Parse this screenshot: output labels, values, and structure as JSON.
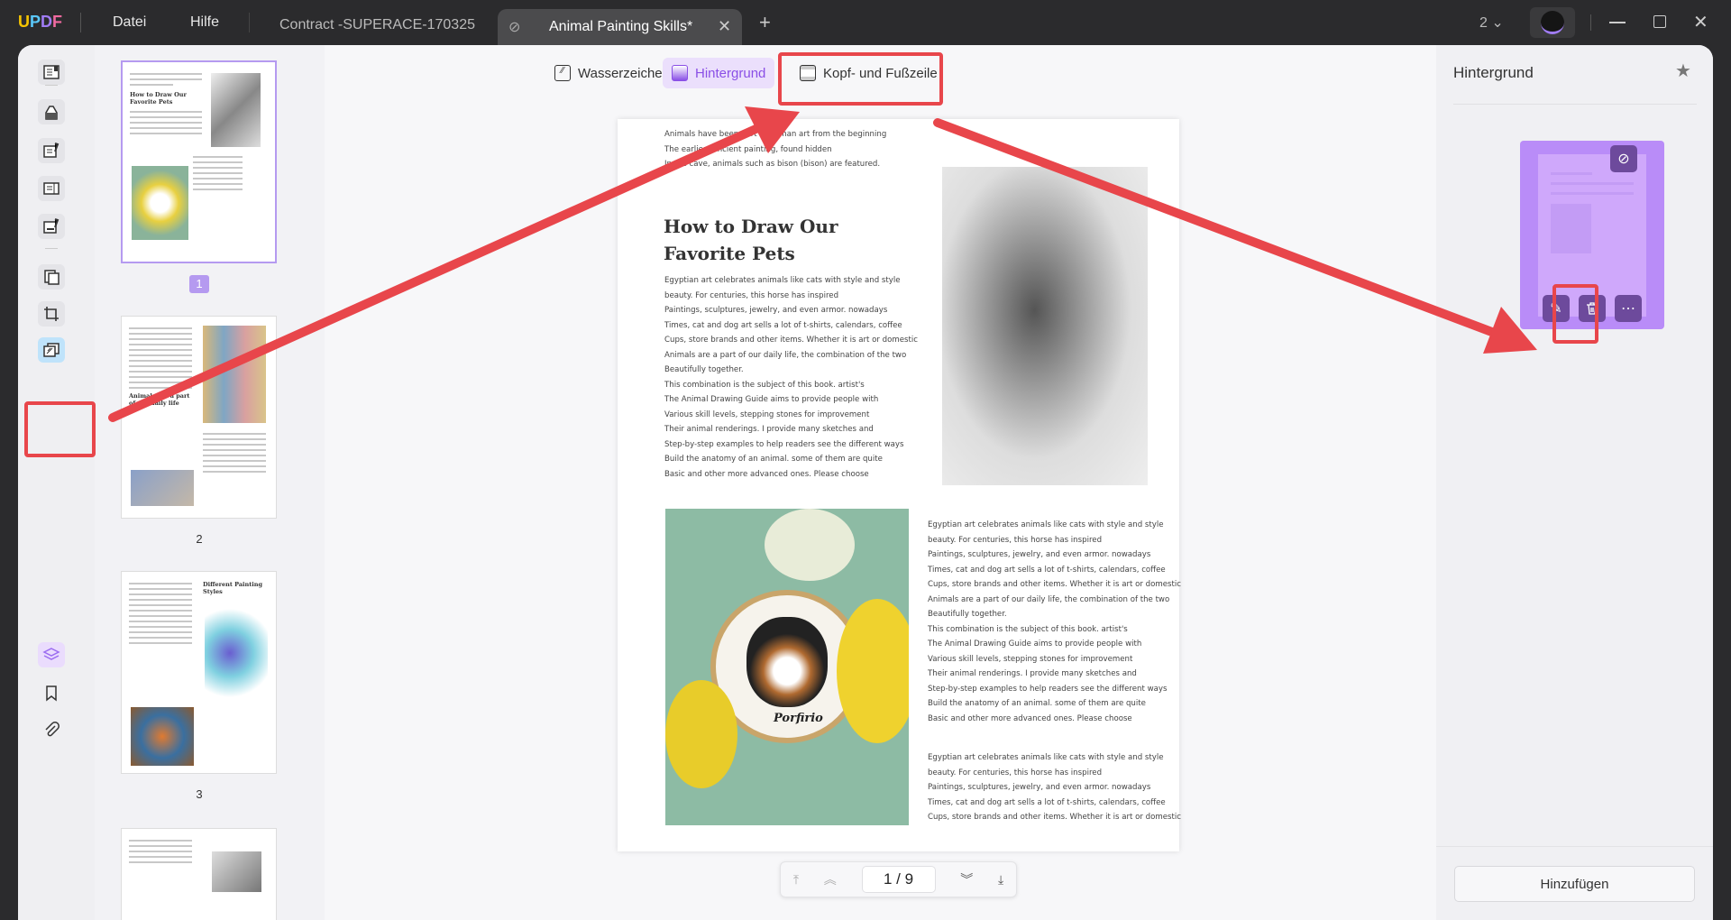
{
  "titlebar": {
    "logo": "UPDF",
    "menu": [
      "Datei",
      "Hilfe"
    ],
    "tabs": [
      {
        "label": "Contract -SUPERACE-170325"
      },
      {
        "label": "Animal Painting Skills*"
      }
    ],
    "new_tab": "+",
    "window_count": "2"
  },
  "toolbar": {
    "items": [
      {
        "label": "Wasserzeichen"
      },
      {
        "label": "Hintergrund",
        "active": true
      },
      {
        "label": "Kopf- und Fußzeile"
      }
    ]
  },
  "thumbnails": {
    "pages": [
      "1",
      "2",
      "3"
    ],
    "titles": [
      "How to Draw Our Favorite Pets",
      "Animals are a part of our daily life",
      "Different Painting Styles"
    ]
  },
  "document": {
    "intro": [
      "Animals have been part of human art from the beginning",
      "The earliest ancient painting, found hidden",
      "In the cave, animals such as bison (bison) are featured."
    ],
    "heading": [
      "How to Draw Our",
      "Favorite Pets"
    ],
    "body": [
      "Egyptian art celebrates animals like cats with style and style",
      "beauty. For centuries, this horse has inspired",
      "Paintings, sculptures, jewelry, and even armor. nowadays",
      "Times, cat and dog art sells a lot of t-shirts, calendars, coffee",
      "Cups, store brands and other items. Whether it is art or domestic",
      "Animals are a part of our daily life, the combination of the two",
      "Beautifully together.",
      "This combination is the subject of this book. artist's",
      "The Animal Drawing Guide aims to provide people with",
      "Various skill levels, stepping stones for improvement",
      "Their animal renderings. I provide many sketches and",
      "Step-by-step examples to help readers see the different ways",
      "Build the anatomy of an animal. some of them are quite",
      "Basic and other more advanced ones. Please choose"
    ],
    "body2": [
      "Egyptian art celebrates animals like cats with style and style",
      "beauty. For centuries, this horse has inspired",
      "Paintings, sculptures, jewelry, and even armor. nowadays",
      "Times, cat and dog art sells a lot of t-shirts, calendars, coffee",
      "Cups, store brands and other items. Whether it is art or domestic"
    ],
    "embroidery_text": "Porfirio"
  },
  "pagenav": {
    "current": "1",
    "total": "9",
    "display": "1 / 9"
  },
  "right_panel": {
    "title": "Hintergrund",
    "add_button": "Hinzufügen"
  },
  "colors": {
    "accent": "#8a4fe6",
    "card": "#b98cf8",
    "annotation": "#e8464b"
  }
}
